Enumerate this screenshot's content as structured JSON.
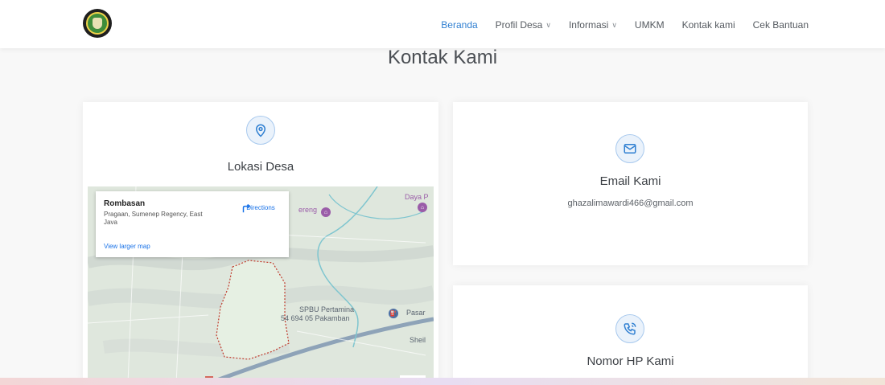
{
  "header": {
    "logo_icon": "village-emblem-icon",
    "nav": [
      {
        "label": "Beranda",
        "active": true
      },
      {
        "label": "Profil Desa",
        "dropdown": true
      },
      {
        "label": "Informasi",
        "dropdown": true
      },
      {
        "label": "UMKM"
      },
      {
        "label": "Kontak kami"
      },
      {
        "label": "Cek Bantuan"
      }
    ]
  },
  "page": {
    "title": "Kontak Kami"
  },
  "location_card": {
    "icon": "location-pin-icon",
    "heading": "Lokasi Desa",
    "map": {
      "place_name": "Rombasan",
      "place_address": "Pragaan, Sumenep Regency, East Java",
      "larger_map_link": "View larger map",
      "directions_label": "Directions",
      "labels": {
        "gas_station": "SPBU Pertamina",
        "gas_station_address": "54 694 05 Pakamban",
        "pasar": "Pasar",
        "sheil": "Sheil",
        "daya": "Daya P",
        "reng": "ereng"
      }
    }
  },
  "email_card": {
    "icon": "mail-icon",
    "heading": "Email Kami",
    "email": "ghazalimawardi466@gmail.com"
  },
  "phone_card": {
    "icon": "phone-icon",
    "heading": "Nomor HP Kami"
  },
  "colors": {
    "accent": "#2f7fd1",
    "nav_text": "#555a60",
    "icon_border": "#a8c9ee"
  }
}
